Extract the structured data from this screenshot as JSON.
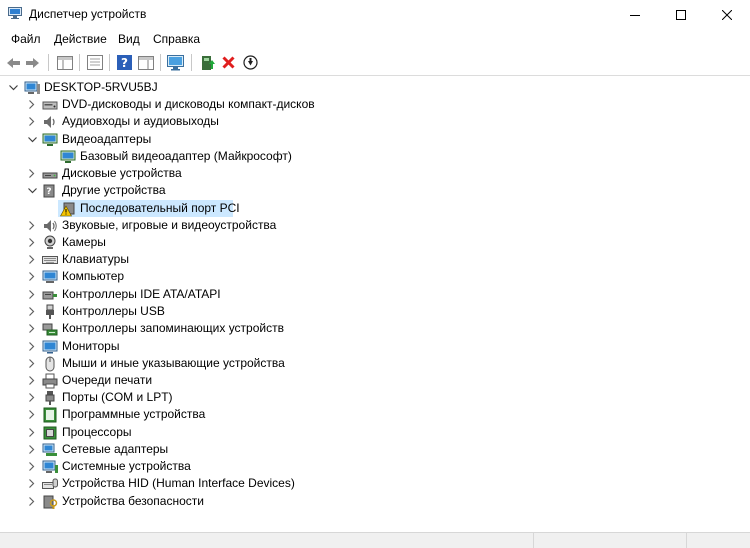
{
  "window": {
    "title": "Диспетчер устройств"
  },
  "menu": [
    "Файл",
    "Действие",
    "Вид",
    "Справка"
  ],
  "tree": {
    "root": "DESKTOP-5RVU5BJ",
    "items": [
      {
        "label": "DVD-дисководы и дисководы компакт-дисков",
        "icon": "dvd-drive-icon",
        "expanded": false,
        "level": 1
      },
      {
        "label": "Аудиовходы и аудиовыходы",
        "icon": "speaker-icon",
        "expanded": false,
        "level": 1
      },
      {
        "label": "Видеоадаптеры",
        "icon": "display-adapter-icon",
        "expanded": true,
        "level": 1
      },
      {
        "label": "Базовый видеоадаптер (Майкрософт)",
        "icon": "display-adapter-icon",
        "level": 2
      },
      {
        "label": "Дисковые устройства",
        "icon": "disk-drive-icon",
        "expanded": false,
        "level": 1
      },
      {
        "label": "Другие устройства",
        "icon": "unknown-device-icon",
        "expanded": true,
        "level": 1
      },
      {
        "label": "Последовательный порт PCI",
        "icon": "warning-device-icon",
        "level": 2,
        "selected": true
      },
      {
        "label": "Звуковые, игровые и видеоустройства",
        "icon": "sound-icon",
        "expanded": false,
        "level": 1
      },
      {
        "label": "Камеры",
        "icon": "camera-icon",
        "expanded": false,
        "level": 1
      },
      {
        "label": "Клавиатуры",
        "icon": "keyboard-icon",
        "expanded": false,
        "level": 1
      },
      {
        "label": "Компьютер",
        "icon": "computer-icon",
        "expanded": false,
        "level": 1
      },
      {
        "label": "Контроллеры IDE ATA/ATAPI",
        "icon": "ide-controller-icon",
        "expanded": false,
        "level": 1
      },
      {
        "label": "Контроллеры USB",
        "icon": "usb-icon",
        "expanded": false,
        "level": 1
      },
      {
        "label": "Контроллеры запоминающих устройств",
        "icon": "storage-controller-icon",
        "expanded": false,
        "level": 1
      },
      {
        "label": "Мониторы",
        "icon": "monitor-icon",
        "expanded": false,
        "level": 1
      },
      {
        "label": "Мыши и иные указывающие устройства",
        "icon": "mouse-icon",
        "expanded": false,
        "level": 1
      },
      {
        "label": "Очереди печати",
        "icon": "printer-icon",
        "expanded": false,
        "level": 1
      },
      {
        "label": "Порты (COM и LPT)",
        "icon": "port-icon",
        "expanded": false,
        "level": 1
      },
      {
        "label": "Программные устройства",
        "icon": "software-device-icon",
        "expanded": false,
        "level": 1
      },
      {
        "label": "Процессоры",
        "icon": "processor-icon",
        "expanded": false,
        "level": 1
      },
      {
        "label": "Сетевые адаптеры",
        "icon": "network-adapter-icon",
        "expanded": false,
        "level": 1
      },
      {
        "label": "Системные устройства",
        "icon": "system-device-icon",
        "expanded": false,
        "level": 1
      },
      {
        "label": "Устройства HID (Human Interface Devices)",
        "icon": "hid-icon",
        "expanded": false,
        "level": 1
      },
      {
        "label": "Устройства безопасности",
        "icon": "security-device-icon",
        "expanded": false,
        "level": 1
      }
    ]
  },
  "colors": {
    "selection": "#cce8ff",
    "accent": "#1a6fc7",
    "warning": "#f5c400",
    "remove": "#e01e1e"
  }
}
